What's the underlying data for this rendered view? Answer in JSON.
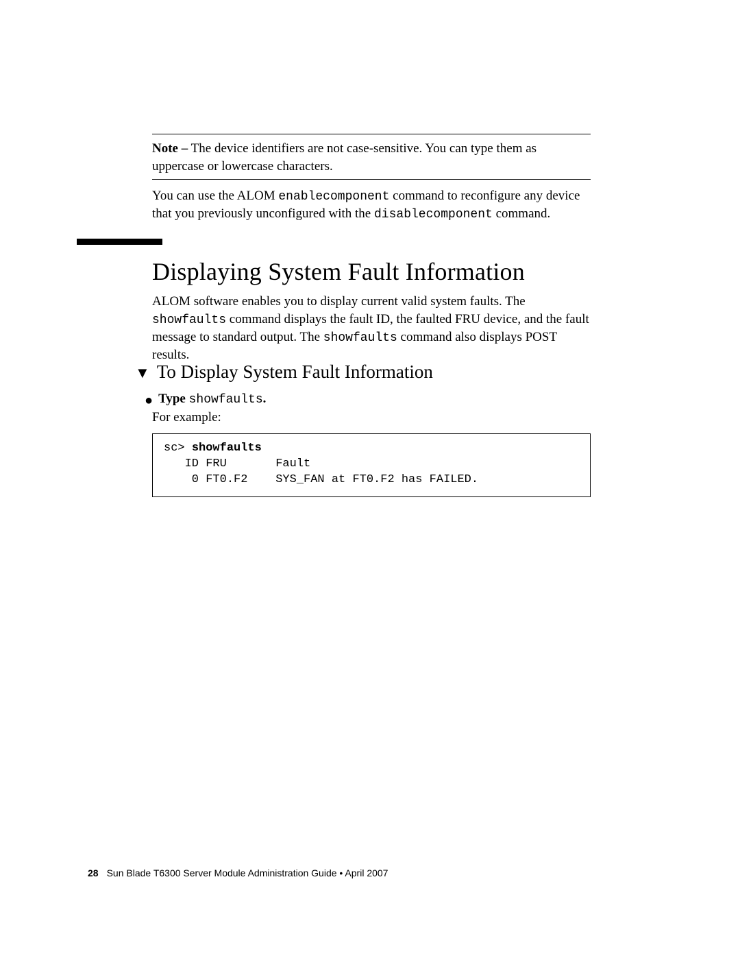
{
  "note": {
    "label": "Note –",
    "text": "The device identifiers are not case-sensitive. You can type them as uppercase or lowercase characters."
  },
  "enable_para": {
    "pre": "You can use the ALOM ",
    "cmd1": "enablecomponent",
    "mid": " command to reconfigure any device that you previously unconfigured with the ",
    "cmd2": "disablecomponent",
    "post": " command."
  },
  "h1": "Displaying System Fault Information",
  "intro": {
    "pre": "ALOM software enables you to display current valid system faults. The ",
    "cmd1": "showfaults",
    "mid": " command displays the fault ID, the faulted FRU device, and the fault message to standard output. The ",
    "cmd2": "showfaults",
    "post": " command also displays POST results."
  },
  "h2": "To Display System Fault Information",
  "step": {
    "label": "Type ",
    "cmd": "showfaults",
    "tail": "."
  },
  "example_lead": "For example:",
  "code": {
    "prompt": "sc> ",
    "cmd": "showfaults",
    "line2": "   ID FRU       Fault",
    "line3": "    0 FT0.F2    SYS_FAN at FT0.F2 has FAILED."
  },
  "footer": {
    "page": "28",
    "title": "Sun Blade T6300 Server Module Administration Guide • April 2007"
  }
}
